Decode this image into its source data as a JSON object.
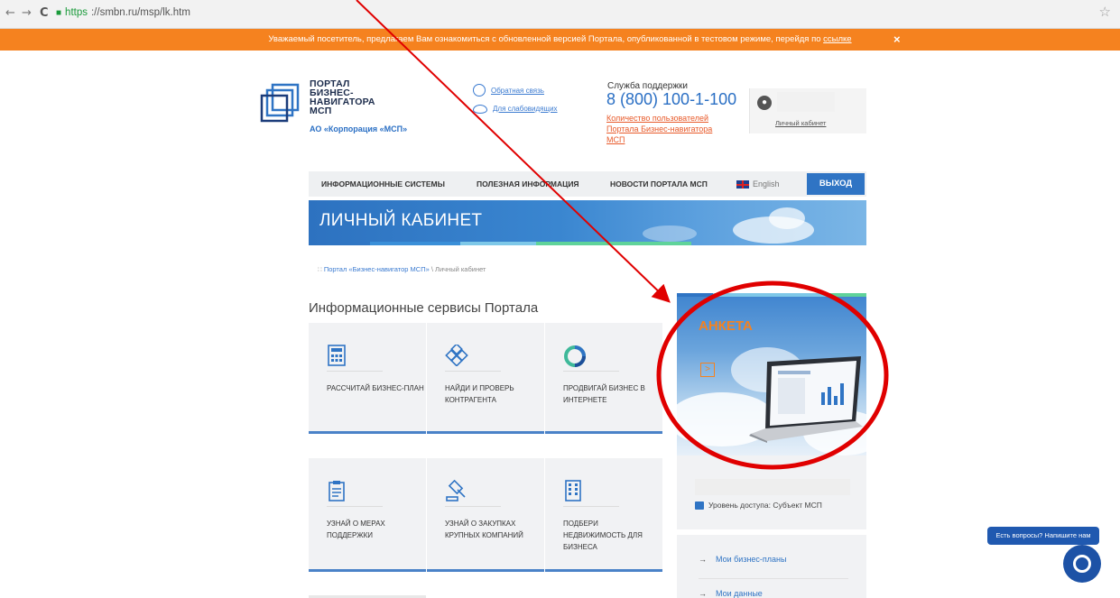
{
  "browser": {
    "back": "←",
    "forward": "→",
    "reload": "C",
    "url_https": "https",
    "url_rest": "://smbn.ru/msp/lk.htm",
    "star": "☆"
  },
  "notice": {
    "text": "Уважаемый посетитель, предлагаем Вам ознакомиться с обновленной версией Портала, опубликованной в тестовом режиме, перейдя по ",
    "link": "ссылке",
    "close": "×",
    "color": "#f5821f"
  },
  "header": {
    "logo_line1": "ПОРТАЛ",
    "logo_line2": "БИЗНЕС-",
    "logo_line3": "НАВИГАТОРА",
    "logo_line4": "МСП",
    "org": "АО «Корпорация «МСП»",
    "feedback": "Обратная связь",
    "accessibility": "Для слабовидящих",
    "support_label": "Служба поддержки",
    "support_phone": "8 (800) 100-1-100",
    "users_link": "Количество пользователей Портала Бизнес-навигатора МСП",
    "cabinet_link": "Личный кабинет"
  },
  "nav": {
    "items": [
      "ИНФОРМАЦИОННЫЕ СИСТЕМЫ",
      "ПОЛЕЗНАЯ ИНФОРМАЦИЯ",
      "НОВОСТИ ПОРТАЛА МСП"
    ],
    "lang": "English",
    "logout": "ВЫХОД"
  },
  "banner": {
    "title": "ЛИЧНЫЙ КАБИНЕТ"
  },
  "breadcrumb": {
    "home": "Портал «Бизнес-навигатор МСП»",
    "sep": " \\ ",
    "current": "Личный кабинет"
  },
  "services": {
    "title": "Информационные сервисы Портала",
    "tiles": [
      {
        "label": "Рассчитай бизнес-план",
        "icon": "calculator-icon"
      },
      {
        "label": "Найди и проверь контрагента",
        "icon": "network-icon"
      },
      {
        "label": "Продвигай бизнес в интернете",
        "icon": "ring-icon"
      },
      {
        "label": "Узнай о мерах поддержки",
        "icon": "clipboard-icon"
      },
      {
        "label": "Узнай о закупках крупных компаний",
        "icon": "gavel-icon"
      },
      {
        "label": "Подбери недвижимость для бизнеса",
        "icon": "building-icon"
      }
    ]
  },
  "promo": {
    "title": "АНКЕТА",
    "arrow": ">"
  },
  "side": {
    "access": "Уровень доступа: Субъект МСП",
    "menu": [
      "Мои бизнес-планы",
      "Мои данные"
    ],
    "arrow": "→"
  },
  "chat": {
    "label": "Есть вопросы? Напишите нам"
  },
  "colors": {
    "accent": "#2f74c4",
    "orange": "#f5821f",
    "annotation": "#e00000"
  }
}
